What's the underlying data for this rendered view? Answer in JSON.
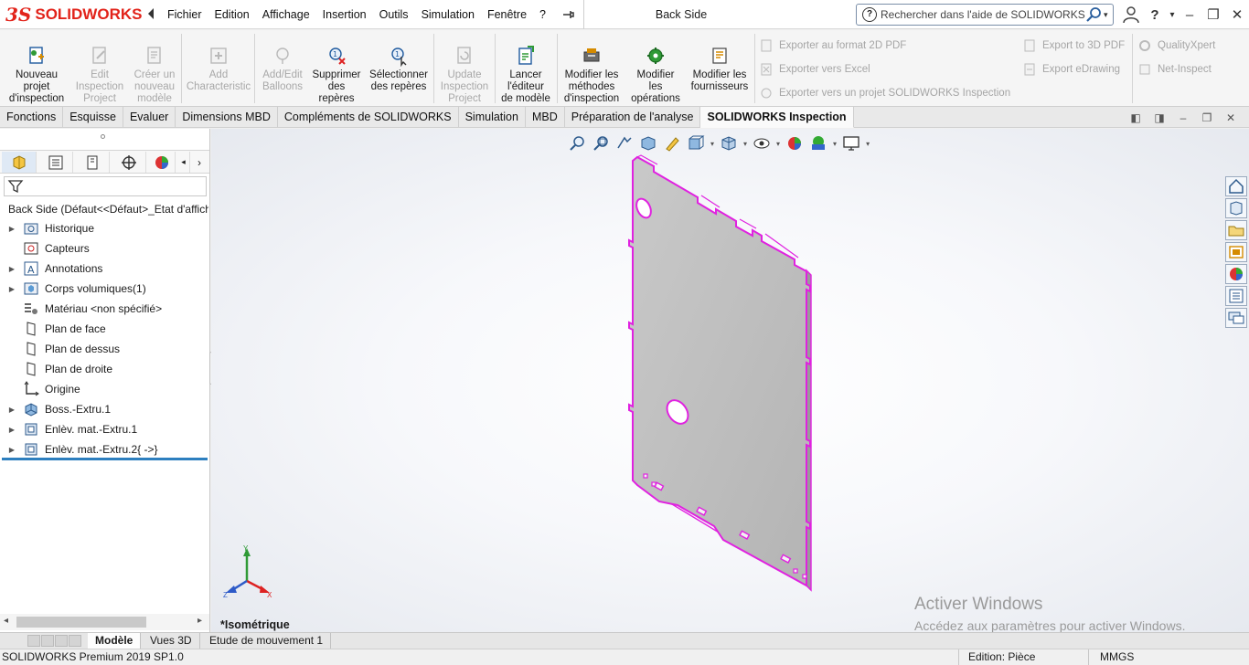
{
  "app": {
    "logo_mark": "3S",
    "logo_name": "SOLIDWORKS",
    "document_title": "Back Side",
    "search_placeholder": "Rechercher dans l'aide de SOLIDWORKS"
  },
  "menu": [
    "Fichier",
    "Edition",
    "Affichage",
    "Insertion",
    "Outils",
    "Simulation",
    "Fenêtre",
    "?"
  ],
  "commands": [
    {
      "lines": [
        "Nouveau",
        "projet",
        "d'inspection"
      ],
      "enabled": true,
      "icon": "new-project-icon"
    },
    {
      "lines": [
        "Edit",
        "Inspection",
        "Project"
      ],
      "enabled": false,
      "icon": "edit-project-icon"
    },
    {
      "lines": [
        "Créer un",
        "nouveau",
        "modèle"
      ],
      "enabled": false,
      "icon": "new-template-icon"
    },
    {
      "lines": [
        "Add",
        "Characteristic"
      ],
      "enabled": false,
      "icon": "add-characteristic-icon"
    },
    {
      "lines": [
        "Add/Edit",
        "Balloons"
      ],
      "enabled": false,
      "icon": "balloons-icon"
    },
    {
      "lines": [
        "Supprimer",
        "des",
        "repères"
      ],
      "enabled": true,
      "icon": "delete-balloons-icon"
    },
    {
      "lines": [
        "Sélectionner",
        "des repères"
      ],
      "enabled": true,
      "icon": "select-balloons-icon"
    },
    {
      "lines": [
        "Update",
        "Inspection",
        "Project"
      ],
      "enabled": false,
      "icon": "update-project-icon"
    },
    {
      "lines": [
        "Lancer",
        "l'éditeur",
        "de modèle"
      ],
      "enabled": true,
      "icon": "template-editor-icon"
    },
    {
      "lines": [
        "Modifier les",
        "méthodes",
        "d'inspection"
      ],
      "enabled": true,
      "icon": "inspection-methods-icon"
    },
    {
      "lines": [
        "Modifier",
        "les",
        "opérations"
      ],
      "enabled": true,
      "icon": "operations-icon"
    },
    {
      "lines": [
        "Modifier les",
        "fournisseurs"
      ],
      "enabled": true,
      "icon": "vendors-icon"
    }
  ],
  "export_commands": [
    "Exporter au format 2D PDF",
    "Exporter vers Excel",
    "Exporter vers un projet SOLIDWORKS Inspection",
    "Export to 3D PDF",
    "Export eDrawing",
    "QualityXpert",
    "Net-Inspect"
  ],
  "tabs": [
    {
      "label": "Fonctions",
      "active": false
    },
    {
      "label": "Esquisse",
      "active": false
    },
    {
      "label": "Evaluer",
      "active": false
    },
    {
      "label": "Dimensions MBD",
      "active": false
    },
    {
      "label": "Compléments de SOLIDWORKS",
      "active": false
    },
    {
      "label": "Simulation",
      "active": false
    },
    {
      "label": "MBD",
      "active": false
    },
    {
      "label": "Préparation de l'analyse",
      "active": false
    },
    {
      "label": "SOLIDWORKS Inspection",
      "active": true
    }
  ],
  "tree": {
    "root": "Back Side  (Défaut<<Défaut>_Etat d'affichage-1>)",
    "items": [
      {
        "label": "Historique",
        "expandable": true,
        "icon": "history-folder-icon"
      },
      {
        "label": "Capteurs",
        "expandable": false,
        "icon": "sensor-icon"
      },
      {
        "label": "Annotations",
        "expandable": true,
        "icon": "annotations-icon"
      },
      {
        "label": "Corps volumiques(1)",
        "expandable": true,
        "icon": "solid-bodies-icon"
      },
      {
        "label": "Matériau <non spécifié>",
        "expandable": false,
        "icon": "material-icon"
      },
      {
        "label": "Plan de face",
        "expandable": false,
        "icon": "plane-icon"
      },
      {
        "label": "Plan de dessus",
        "expandable": false,
        "icon": "plane-icon"
      },
      {
        "label": "Plan de droite",
        "expandable": false,
        "icon": "plane-icon"
      },
      {
        "label": "Origine",
        "expandable": false,
        "icon": "origin-icon"
      },
      {
        "label": "Boss.-Extru.1",
        "expandable": true,
        "icon": "boss-extrude-icon"
      },
      {
        "label": "Enlèv. mat.-Extru.1",
        "expandable": true,
        "icon": "cut-extrude-icon"
      },
      {
        "label": "Enlèv. mat.-Extru.2{ ->}",
        "expandable": true,
        "icon": "cut-extrude-icon"
      }
    ]
  },
  "viewport": {
    "view_name": "*Isométrique",
    "part_edge_color": "#e022e0",
    "part_face_color": "#bdbdbd",
    "triad": {
      "x": "X",
      "y": "Y",
      "z": "Z"
    },
    "watermark_title": "Activer Windows",
    "watermark_text": "Accédez aux paramètres pour activer Windows."
  },
  "bottom_tabs": [
    {
      "label": "Modèle",
      "active": true
    },
    {
      "label": "Vues 3D",
      "active": false
    },
    {
      "label": "Etude de mouvement 1",
      "active": false
    }
  ],
  "status": {
    "product": "SOLIDWORKS Premium 2019 SP1.0",
    "edit_mode": "Edition: Pièce",
    "units": "MMGS"
  }
}
